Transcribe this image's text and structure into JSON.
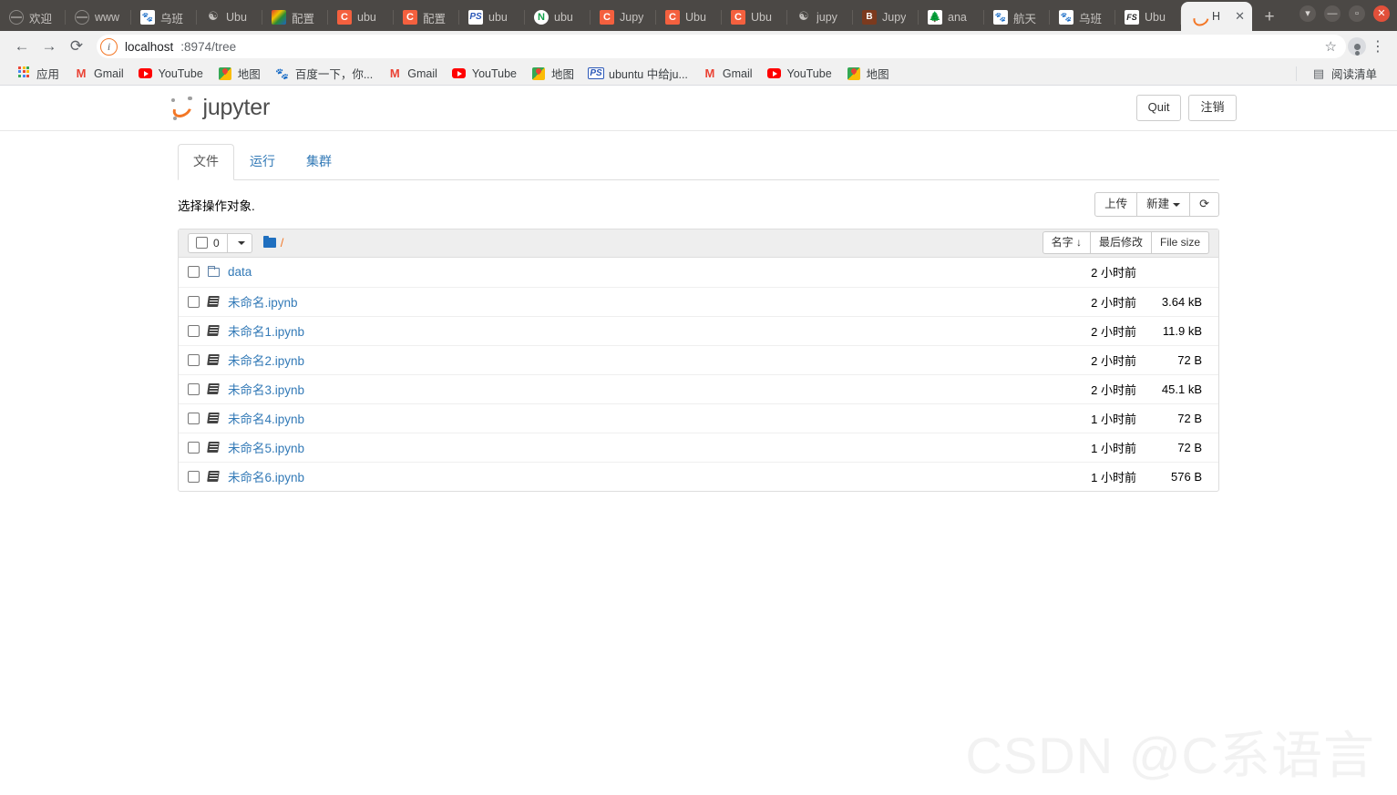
{
  "browser": {
    "tabs": [
      {
        "label": "欢迎",
        "icon": "globe-icon",
        "icon_kind": "globe",
        "active": false
      },
      {
        "label": "www",
        "icon": "globe-icon",
        "icon_kind": "globe",
        "active": false
      },
      {
        "label": "乌班",
        "icon": "baidu-icon",
        "icon_kind": "baidu",
        "active": false
      },
      {
        "label": "Ubu",
        "icon": "ubuntu-icon",
        "icon_kind": "ubuntu",
        "active": false
      },
      {
        "label": "配置",
        "icon": "colorful-icon",
        "icon_kind": "colorful",
        "active": false
      },
      {
        "label": "ubu",
        "icon": "csdn-icon",
        "icon_kind": "c",
        "active": false
      },
      {
        "label": "配置",
        "icon": "csdn-icon",
        "icon_kind": "c",
        "active": false
      },
      {
        "label": "ubu",
        "icon": "photoshop-icon",
        "icon_kind": "ps",
        "active": false
      },
      {
        "label": "ubu",
        "icon": "node-icon",
        "icon_kind": "n",
        "active": false
      },
      {
        "label": "Jupy",
        "icon": "csdn-icon",
        "icon_kind": "c",
        "active": false
      },
      {
        "label": "Ubu",
        "icon": "csdn-icon",
        "icon_kind": "c",
        "active": false
      },
      {
        "label": "Ubu",
        "icon": "csdn-icon",
        "icon_kind": "c",
        "active": false
      },
      {
        "label": "jupy",
        "icon": "ubuntu-icon",
        "icon_kind": "ubuntu",
        "active": false
      },
      {
        "label": "Jupy",
        "icon": "ebook-icon",
        "icon_kind": "ebook",
        "active": false
      },
      {
        "label": "ana",
        "icon": "anaconda-icon",
        "icon_kind": "ana",
        "active": false
      },
      {
        "label": "航天",
        "icon": "baidu-icon",
        "icon_kind": "baidu",
        "active": false
      },
      {
        "label": "乌班",
        "icon": "baidu-icon",
        "icon_kind": "baidu",
        "active": false
      },
      {
        "label": "Ubu",
        "icon": "fs-icon",
        "icon_kind": "fs",
        "active": false
      },
      {
        "label": "H",
        "icon": "jupyter-icon",
        "icon_kind": "jupyter",
        "active": true
      }
    ],
    "new_tab_label": "+",
    "window_controls": {
      "menu": "▾",
      "minimize": "—",
      "maximize": "▫",
      "close": "✕"
    },
    "nav": {
      "back": "←",
      "forward": "→",
      "reload": "⟳"
    },
    "omnibox": {
      "info_icon": "ⓘ",
      "url_host": "localhost",
      "url_rest": ":8974/tree",
      "star_icon": "☆",
      "menu_icon": "⋮"
    },
    "bookmarks": [
      {
        "label": "应用",
        "icon_kind": "apps"
      },
      {
        "label": "Gmail",
        "icon_kind": "gmail"
      },
      {
        "label": "YouTube",
        "icon_kind": "youtube"
      },
      {
        "label": "地图",
        "icon_kind": "maps"
      },
      {
        "label": "百度一下，你...",
        "icon_kind": "baidu"
      },
      {
        "label": "Gmail",
        "icon_kind": "gmail"
      },
      {
        "label": "YouTube",
        "icon_kind": "youtube"
      },
      {
        "label": "地图",
        "icon_kind": "maps"
      },
      {
        "label": "ubuntu 中给ju...",
        "icon_kind": "ps"
      },
      {
        "label": "Gmail",
        "icon_kind": "gmail"
      },
      {
        "label": "YouTube",
        "icon_kind": "youtube"
      },
      {
        "label": "地图",
        "icon_kind": "maps"
      }
    ],
    "reading_list": {
      "label": "阅读清单",
      "icon": "reading-list-icon"
    }
  },
  "jupyter": {
    "brand": "jupyter",
    "header_buttons": [
      {
        "label": "Quit",
        "name": "quit-button"
      },
      {
        "label": "注销",
        "name": "logout-button"
      }
    ],
    "tabs": [
      {
        "label": "文件",
        "active": true
      },
      {
        "label": "运行",
        "active": false
      },
      {
        "label": "集群",
        "active": false
      }
    ],
    "select_note": "选择操作对象.",
    "toolbar": {
      "upload_label": "上传",
      "new_label": "新建",
      "refresh_icon": "refresh-icon"
    },
    "list_header": {
      "select_count": "0",
      "dropdown_caret": "▾",
      "breadcrumb_root": "/",
      "sort_name": "名字 ↓",
      "sort_modified": "最后修改",
      "sort_size": "File size"
    },
    "files": [
      {
        "name": "data",
        "type": "folder",
        "modified": "2 小时前",
        "size": ""
      },
      {
        "name": "未命名.ipynb",
        "type": "notebook",
        "modified": "2 小时前",
        "size": "3.64 kB"
      },
      {
        "name": "未命名1.ipynb",
        "type": "notebook",
        "modified": "2 小时前",
        "size": "11.9 kB"
      },
      {
        "name": "未命名2.ipynb",
        "type": "notebook",
        "modified": "2 小时前",
        "size": "72 B"
      },
      {
        "name": "未命名3.ipynb",
        "type": "notebook",
        "modified": "2 小时前",
        "size": "45.1 kB"
      },
      {
        "name": "未命名4.ipynb",
        "type": "notebook",
        "modified": "1 小时前",
        "size": "72 B"
      },
      {
        "name": "未命名5.ipynb",
        "type": "notebook",
        "modified": "1 小时前",
        "size": "72 B"
      },
      {
        "name": "未命名6.ipynb",
        "type": "notebook",
        "modified": "1 小时前",
        "size": "576 B"
      }
    ]
  },
  "watermark": "CSDN @C系语言",
  "colors": {
    "jupyter_orange": "#f37726",
    "link_blue": "#337ab7",
    "chrome_tabstrip": "#4b4845",
    "chrome_toolbar": "#f1f1f1"
  }
}
